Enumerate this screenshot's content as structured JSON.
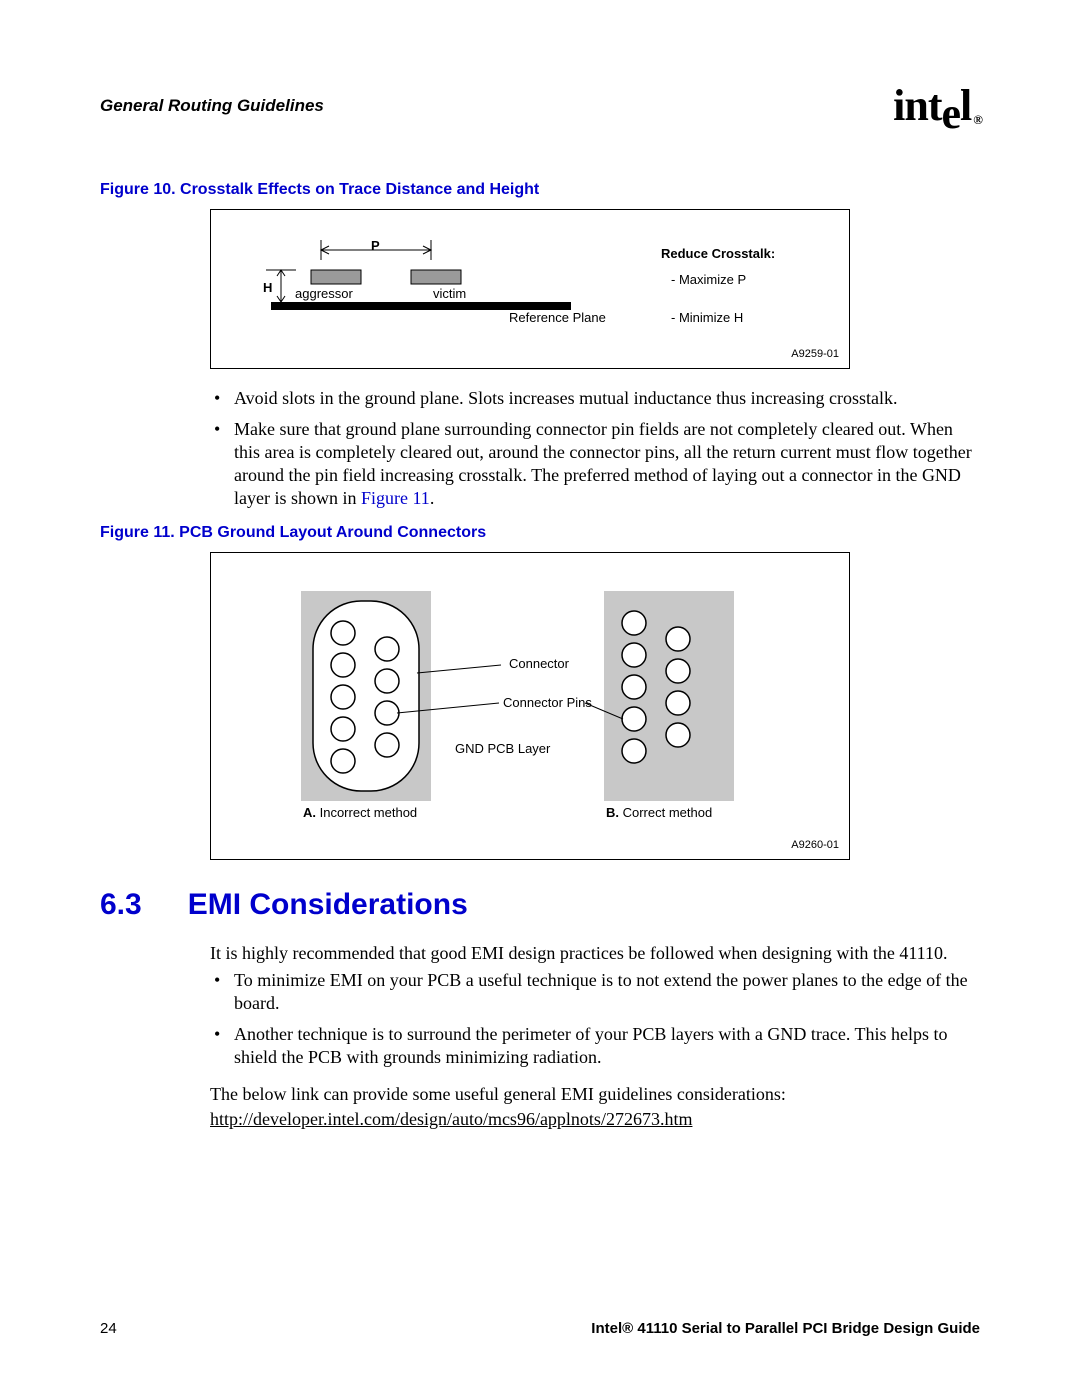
{
  "header": {
    "left": "General Routing Guidelines",
    "logo_text": "intel",
    "logo_reg": "®"
  },
  "figure10": {
    "caption": "Figure 10. Crosstalk Effects on Trace Distance and Height",
    "label_P": "P",
    "label_H": "H",
    "label_aggressor": "aggressor",
    "label_victim": "victim",
    "label_refplane": "Reference Plane",
    "box_title": "Reduce Crosstalk:",
    "box_line1": "- Maximize P",
    "box_line2": "- Minimize H",
    "code": "A9259-01"
  },
  "bullets_top": [
    "Avoid slots in the ground plane. Slots increases mutual inductance thus increasing crosstalk.",
    "Make sure that ground plane surrounding connector pin fields are not completely cleared out. When this area is completely cleared out, around the connector pins, all the return current must flow together around the pin field increasing crosstalk. The preferred method of laying out a connector in the GND layer is shown in "
  ],
  "fig11_ref": "Figure 11",
  "bullets_top_tail": ".",
  "figure11": {
    "caption": "Figure 11. PCB Ground Layout Around Connectors",
    "label_connector": "Connector",
    "label_pins": "Connector Pins",
    "label_gnd": "GND PCB Layer",
    "label_A_bold": "A.",
    "label_A_rest": " Incorrect method",
    "label_B_bold": "B.",
    "label_B_rest": " Correct method",
    "code": "A9260-01"
  },
  "section": {
    "num": "6.3",
    "title": "EMI Considerations",
    "para1": "It is highly recommended that good EMI design practices be followed when designing with the 41110.",
    "bullets": [
      "To minimize EMI on your PCB a useful technique is to not extend the power planes to the edge of the board.",
      "Another technique is to surround the perimeter of your PCB layers with a GND trace. This helps to shield the PCB with grounds minimizing radiation."
    ],
    "para2": "The below link can provide some useful general EMI guidelines considerations:",
    "link": "http://developer.intel.com/design/auto/mcs96/applnots/272673.htm"
  },
  "footer": {
    "page": "24",
    "title": "Intel® 41110 Serial to Parallel PCI Bridge Design Guide"
  }
}
